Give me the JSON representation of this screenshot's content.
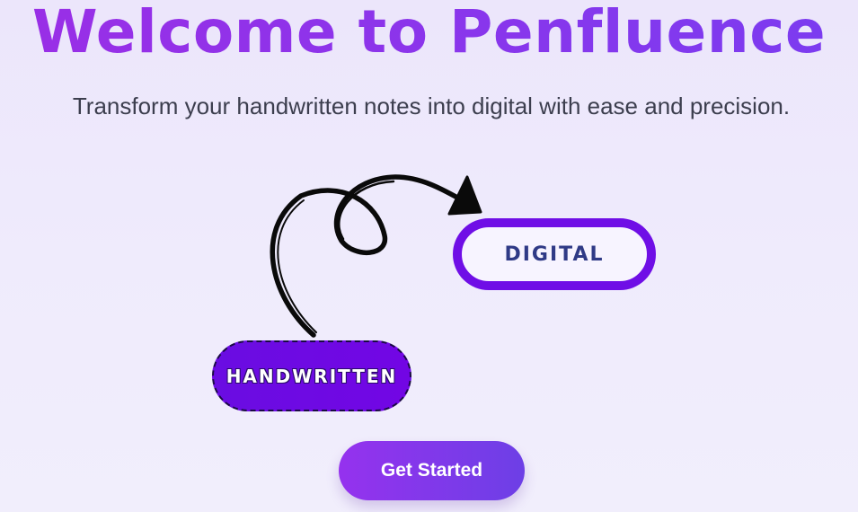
{
  "hero": {
    "title": "Welcome to Penfluence",
    "subtitle": "Transform your handwritten notes into digital with ease and precision."
  },
  "illustration": {
    "digital_label": "DIGITAL",
    "handwritten_label": "HANDWRITTEN",
    "arrow_icon": "hand-drawn-loop-arrow"
  },
  "cta": {
    "label": "Get Started"
  },
  "colors": {
    "title_gradient": [
      "#9a2ee6",
      "#7b3cf0"
    ],
    "pill_purple": "#6f0ee6",
    "digital_text": "#2f3a86",
    "cta_gradient": [
      "#9532ee",
      "#6d3fe6"
    ],
    "background": "#ece6fb"
  }
}
